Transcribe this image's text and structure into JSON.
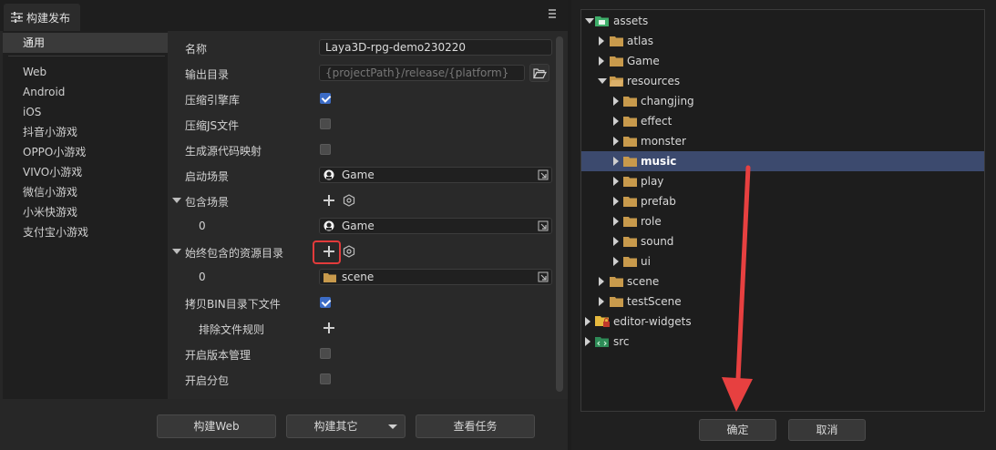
{
  "panel": {
    "tab_title": "构建发布"
  },
  "sidebar": {
    "items": [
      {
        "label": "通用",
        "active": true
      },
      {
        "label": "Web"
      },
      {
        "label": "Android"
      },
      {
        "label": "iOS"
      },
      {
        "label": "抖音小游戏"
      },
      {
        "label": "OPPO小游戏"
      },
      {
        "label": "VIVO小游戏"
      },
      {
        "label": "微信小游戏"
      },
      {
        "label": "小米快游戏"
      },
      {
        "label": "支付宝小游戏"
      }
    ]
  },
  "settings": {
    "name_label": "名称",
    "name_value": "Laya3D-rpg-demo230220",
    "output_label": "输出目录",
    "output_placeholder": "{projectPath}/release/{platform}",
    "compress_engine_label": "压缩引擎库",
    "compress_engine_checked": true,
    "compress_js_label": "压缩JS文件",
    "compress_js_checked": false,
    "sourcemap_label": "生成源代码映射",
    "sourcemap_checked": false,
    "start_scene_label": "启动场景",
    "start_scene_value": "Game",
    "include_scenes_label": "包含场景",
    "include_scenes_index": "0",
    "include_scenes_value": "Game",
    "always_include_label": "始终包含的资源目录",
    "always_include_index": "0",
    "always_include_value": "scene",
    "copy_bin_label": "拷贝BIN目录下文件",
    "copy_bin_checked": true,
    "exclude_rules_label": "排除文件规则",
    "version_mgmt_label": "开启版本管理",
    "version_mgmt_checked": false,
    "subpackage_label": "开启分包",
    "subpackage_checked": false
  },
  "buttons": {
    "build_web": "构建Web",
    "build_other": "构建其它",
    "view_tasks": "查看任务"
  },
  "tree": {
    "items": [
      {
        "label": "assets",
        "depth": 0,
        "expanded": true,
        "icon": "assets-folder-icon"
      },
      {
        "label": "atlas",
        "depth": 1,
        "icon": "folder-icon"
      },
      {
        "label": "Game",
        "depth": 1,
        "icon": "folder-icon"
      },
      {
        "label": "resources",
        "depth": 1,
        "expanded": true,
        "icon": "folder-icon"
      },
      {
        "label": "changjing",
        "depth": 2,
        "icon": "folder-icon"
      },
      {
        "label": "effect",
        "depth": 2,
        "icon": "folder-icon"
      },
      {
        "label": "monster",
        "depth": 2,
        "icon": "folder-icon"
      },
      {
        "label": "music",
        "depth": 2,
        "icon": "folder-icon",
        "selected": true
      },
      {
        "label": "play",
        "depth": 2,
        "icon": "folder-icon"
      },
      {
        "label": "prefab",
        "depth": 2,
        "icon": "folder-icon"
      },
      {
        "label": "role",
        "depth": 2,
        "icon": "folder-icon"
      },
      {
        "label": "sound",
        "depth": 2,
        "icon": "folder-icon"
      },
      {
        "label": "ui",
        "depth": 2,
        "icon": "folder-icon"
      },
      {
        "label": "scene",
        "depth": 1,
        "icon": "folder-icon"
      },
      {
        "label": "testScene",
        "depth": 1,
        "icon": "folder-icon"
      },
      {
        "label": "editor-widgets",
        "depth": 0,
        "icon": "locked-folder-icon"
      },
      {
        "label": "src",
        "depth": 0,
        "icon": "code-folder-icon"
      }
    ]
  },
  "dialog": {
    "ok": "确定",
    "cancel": "取消"
  },
  "colors": {
    "accent_check": "#3c6cc6",
    "selection": "#3c4a6e",
    "highlight_red": "#e23b3b",
    "folder": "#c89a4c"
  }
}
